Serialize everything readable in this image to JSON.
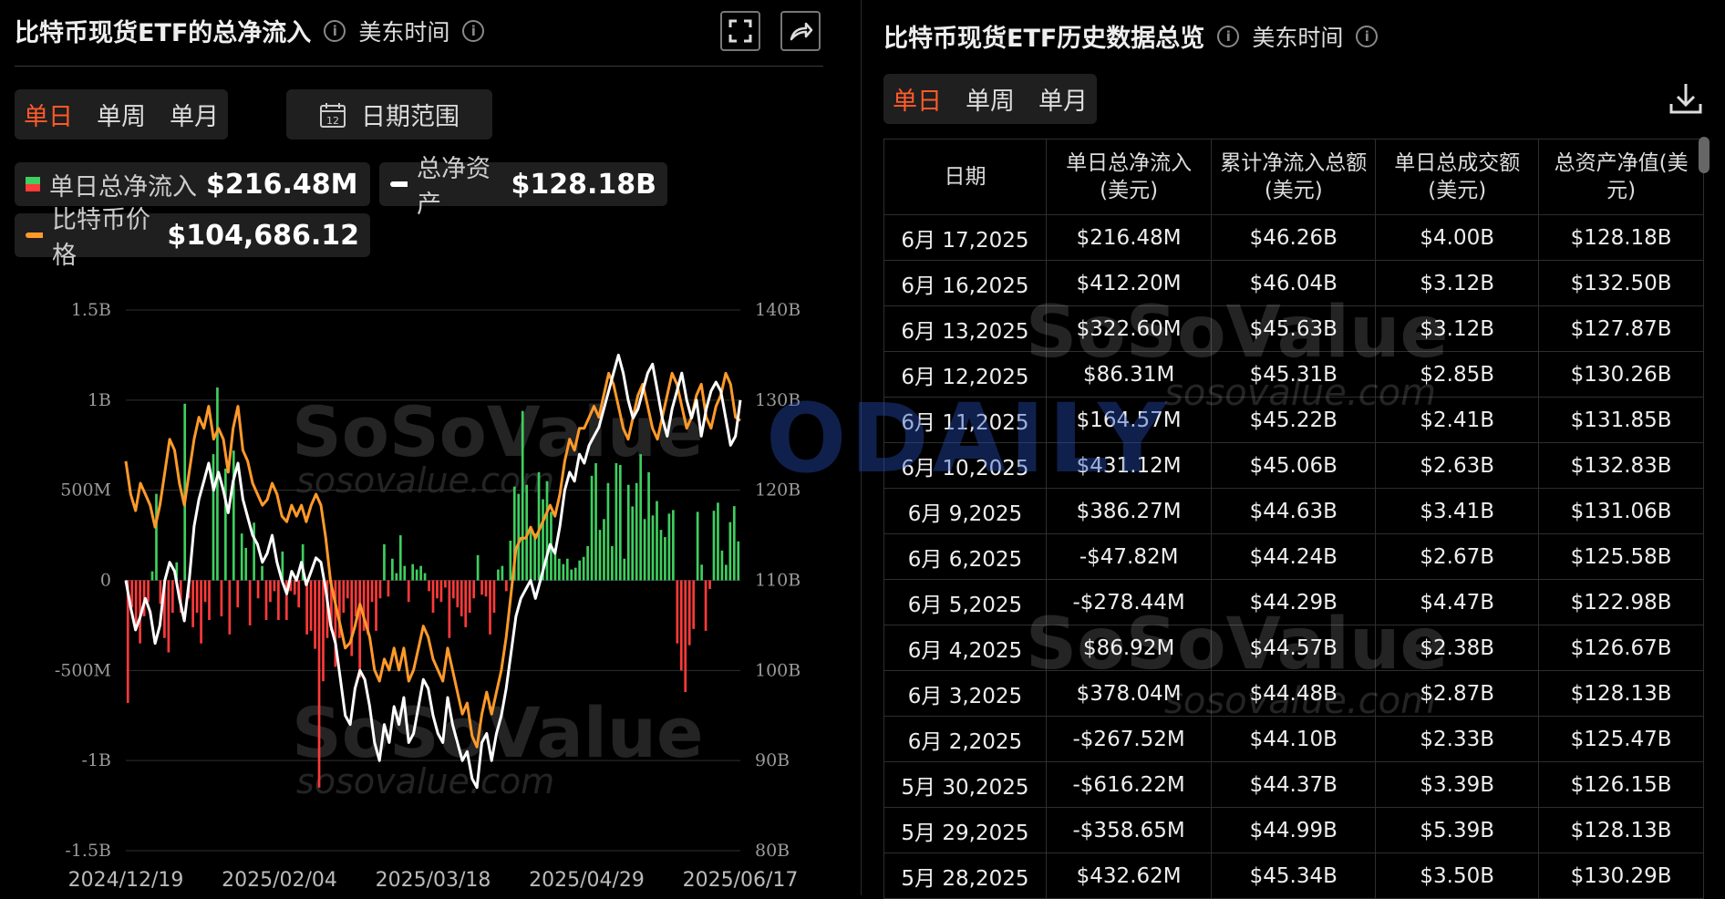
{
  "left_panel": {
    "title": "比特币现货ETF的总净流入",
    "timezone": "美东时间",
    "tabs": [
      "单日",
      "单周",
      "单月"
    ],
    "active_tab": 0,
    "date_range_label": "日期范围",
    "calendar_day": "12",
    "legend": [
      {
        "label": "单日总净流入",
        "value": "$216.48M"
      },
      {
        "label": "总净资产",
        "value": "$128.18B"
      },
      {
        "label": "比特币价格",
        "value": "$104,686.12"
      }
    ]
  },
  "right_panel": {
    "title": "比特币现货ETF历史数据总览",
    "timezone": "美东时间",
    "tabs": [
      "单日",
      "单周",
      "单月"
    ],
    "active_tab": 0,
    "columns": [
      "日期",
      "单日总净流入(美元)",
      "累计净流入总额(美元)",
      "单日总成交额(美元)",
      "总资产净值(美元)"
    ],
    "rows": [
      [
        "6月 17,2025",
        "$216.48M",
        "$46.26B",
        "$4.00B",
        "$128.18B"
      ],
      [
        "6月 16,2025",
        "$412.20M",
        "$46.04B",
        "$3.12B",
        "$132.50B"
      ],
      [
        "6月 13,2025",
        "$322.60M",
        "$45.63B",
        "$3.12B",
        "$127.87B"
      ],
      [
        "6月 12,2025",
        "$86.31M",
        "$45.31B",
        "$2.85B",
        "$130.26B"
      ],
      [
        "6月 11,2025",
        "$164.57M",
        "$45.22B",
        "$2.41B",
        "$131.85B"
      ],
      [
        "6月 10,2025",
        "$431.12M",
        "$45.06B",
        "$2.63B",
        "$132.83B"
      ],
      [
        "6月 9,2025",
        "$386.27M",
        "$44.63B",
        "$3.41B",
        "$131.06B"
      ],
      [
        "6月 6,2025",
        "-$47.82M",
        "$44.24B",
        "$2.67B",
        "$125.58B"
      ],
      [
        "6月 5,2025",
        "-$278.44M",
        "$44.29B",
        "$4.47B",
        "$122.98B"
      ],
      [
        "6月 4,2025",
        "$86.92M",
        "$44.57B",
        "$2.38B",
        "$126.67B"
      ],
      [
        "6月 3,2025",
        "$378.04M",
        "$44.48B",
        "$2.87B",
        "$128.13B"
      ],
      [
        "6月 2,2025",
        "-$267.52M",
        "$44.10B",
        "$2.33B",
        "$125.47B"
      ],
      [
        "5月 30,2025",
        "-$616.22M",
        "$44.37B",
        "$3.39B",
        "$126.15B"
      ],
      [
        "5月 29,2025",
        "-$358.65M",
        "$44.99B",
        "$5.39B",
        "$128.13B"
      ],
      [
        "5月 28,2025",
        "$432.62M",
        "$45.34B",
        "$3.50B",
        "$130.29B"
      ]
    ]
  },
  "watermarks": {
    "brand": "SoSoValue",
    "site": "sosovalue.com",
    "odaily": "ODAILY"
  },
  "colors": {
    "inflow": "#3fce5f",
    "outflow": "#ff3a3a",
    "net_assets": "#ffffff",
    "btc_price": "#ff9a2a",
    "accent": "#ff5a2a"
  },
  "chart_data": {
    "type": "bar+line",
    "x_ticks": [
      "2024/12/19",
      "2025/02/04",
      "2025/03/18",
      "2025/04/29",
      "2025/06/17"
    ],
    "y_left_ticks": [
      "1.5B",
      "1B",
      "500M",
      "0",
      "-500M",
      "-1B",
      "-1.5B"
    ],
    "y_left_range": [
      -1500000000,
      1500000000
    ],
    "y_right_ticks": [
      "140B",
      "130B",
      "120B",
      "110B",
      "100B",
      "90B",
      "80B"
    ],
    "y_right_range": [
      80,
      140
    ],
    "series": [
      {
        "name": "单日总净流入",
        "kind": "bar",
        "axis": "left",
        "unit": "M",
        "values": [
          -680,
          -150,
          -250,
          -350,
          -200,
          -120,
          50,
          480,
          -130,
          -320,
          -400,
          -180,
          100,
          -180,
          980,
          -100,
          -260,
          -180,
          -350,
          -120,
          -220,
          700,
          1070,
          -200,
          620,
          -300,
          720,
          -150,
          260,
          180,
          -250,
          320,
          -100,
          80,
          -220,
          -120,
          -60,
          -220,
          160,
          -220,
          -60,
          -80,
          -150,
          200,
          -300,
          -280,
          -380,
          -1150,
          -560,
          -320,
          -280,
          -480,
          -320,
          -180,
          -100,
          -420,
          -200,
          -540,
          -280,
          -300,
          -120,
          -280,
          -100,
          200,
          -90,
          120,
          40,
          250,
          80,
          -120,
          90,
          60,
          80,
          40,
          -60,
          -180,
          -100,
          -120,
          -40,
          -320,
          -100,
          -150,
          -200,
          -260,
          -180,
          -100,
          140,
          -80,
          -90,
          -300,
          -180,
          60,
          80,
          -60,
          220,
          520,
          480,
          940,
          530,
          300,
          260,
          600,
          450,
          550,
          380,
          170,
          120,
          90,
          120,
          60,
          70,
          110,
          130,
          190,
          580,
          650,
          280,
          340,
          540,
          190,
          650,
          640,
          120,
          530,
          410,
          540,
          700,
          340,
          600,
          360,
          440,
          280,
          240,
          370,
          390,
          -350,
          -500,
          -620,
          -360,
          -270,
          380,
          87,
          -280,
          -48,
          386,
          431,
          165,
          86,
          323,
          412,
          216
        ]
      },
      {
        "name": "总净资产",
        "kind": "line",
        "axis": "right",
        "unit": "B",
        "values": [
          110,
          107,
          104.5,
          106,
          108,
          106.5,
          103,
          105,
          110,
          112,
          111,
          108,
          105.5,
          110,
          116,
          119,
          121,
          123,
          120,
          122,
          120,
          117.5,
          121,
          123,
          119,
          117,
          115,
          114,
          112,
          113,
          115,
          112,
          110,
          108.5,
          111,
          110,
          112,
          109.5,
          111,
          112.5,
          112,
          109,
          105,
          103,
          99,
          95,
          94,
          98,
          100,
          99,
          96,
          92,
          90,
          94,
          92,
          96,
          94,
          97,
          92,
          93,
          96,
          99,
          98,
          95,
          93,
          92,
          97,
          94,
          92,
          90,
          91,
          88,
          87,
          92,
          93,
          90,
          93,
          95,
          98,
          102,
          106,
          108,
          109,
          110,
          108,
          110,
          112,
          114,
          113,
          116,
          120,
          122,
          121,
          124,
          123,
          125,
          126,
          127,
          129,
          131,
          133,
          135,
          133,
          130,
          128,
          129,
          131,
          133,
          134,
          131,
          128,
          126,
          129,
          131,
          133,
          130,
          128,
          130,
          126,
          129,
          131,
          132,
          131,
          128,
          125,
          126,
          130
        ]
      },
      {
        "name": "比特币价格",
        "kind": "line",
        "axis": "right",
        "unit": "K",
        "values": [
          101,
          98,
          96.5,
          99,
          98,
          97,
          95,
          97,
          100,
          103,
          102,
          99,
          97,
          100,
          103,
          105,
          104,
          106,
          103,
          104,
          103,
          100,
          104,
          106,
          102,
          101,
          99,
          98,
          97,
          97.5,
          99,
          98,
          96,
          95.5,
          97,
          96,
          97,
          95.5,
          97,
          98,
          97,
          94,
          90,
          88,
          86,
          84,
          84.5,
          86,
          88,
          86.5,
          85,
          82,
          81,
          83,
          82,
          84,
          82,
          84,
          81,
          82,
          84,
          86,
          85,
          83,
          82,
          81,
          84,
          82,
          80,
          78,
          79,
          76,
          75,
          78,
          80,
          78,
          80,
          82,
          85,
          89,
          93,
          94,
          94,
          95,
          94,
          95,
          96,
          97,
          96,
          98,
          101,
          103,
          102,
          104,
          104,
          105,
          106,
          105,
          107,
          109,
          108,
          106,
          104,
          103,
          105,
          107,
          108,
          106,
          104,
          103,
          105,
          107,
          109,
          108,
          106,
          104,
          105,
          107,
          108,
          105,
          104,
          106,
          107,
          109,
          108,
          105,
          104.7
        ]
      }
    ]
  }
}
